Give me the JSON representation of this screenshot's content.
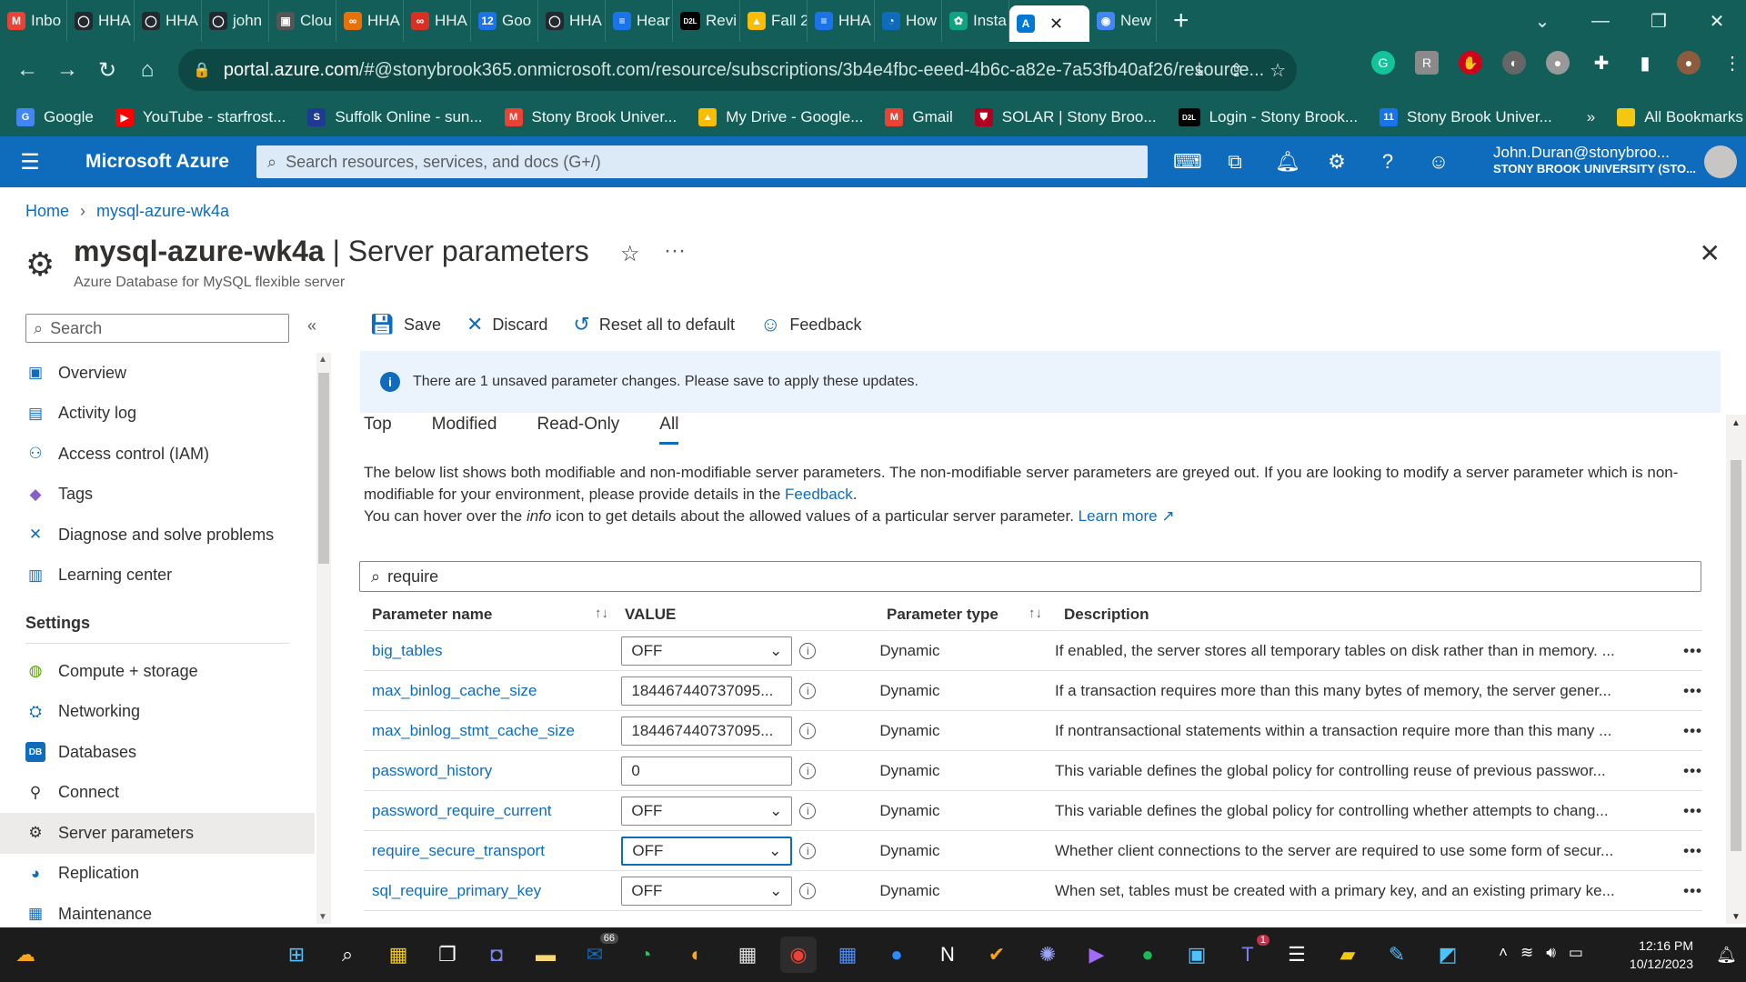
{
  "browser": {
    "tabs": [
      {
        "label": "Inbo",
        "icon": "gmail-icon",
        "color": "#ea4335",
        "glyph": "M"
      },
      {
        "label": "HHA",
        "icon": "github-icon",
        "color": "#24292f",
        "glyph": "◯"
      },
      {
        "label": "HHA",
        "icon": "github-icon",
        "color": "#24292f",
        "glyph": "◯"
      },
      {
        "label": "john",
        "icon": "github-icon",
        "color": "#24292f",
        "glyph": "◯"
      },
      {
        "label": "Clou",
        "icon": "terminal-icon",
        "color": "#555",
        "glyph": "▣"
      },
      {
        "label": "HHA",
        "icon": "infinity-icon",
        "color": "#e8710a",
        "glyph": "∞"
      },
      {
        "label": "HHA",
        "icon": "infinity-icon",
        "color": "#d93025",
        "glyph": "∞"
      },
      {
        "label": "Goo",
        "icon": "calendar-icon",
        "color": "#1a73e8",
        "glyph": "12"
      },
      {
        "label": "HHA",
        "icon": "github-icon",
        "color": "#24292f",
        "glyph": "◯"
      },
      {
        "label": "Hear",
        "icon": "docs-icon",
        "color": "#1a73e8",
        "glyph": "≡"
      },
      {
        "label": "Revi",
        "icon": "d2l-icon",
        "color": "#000",
        "glyph": "D2L"
      },
      {
        "label": "Fall 2",
        "icon": "drive-icon",
        "color": "#fbbc04",
        "glyph": "▲"
      },
      {
        "label": "HHA",
        "icon": "docs-icon",
        "color": "#1a73e8",
        "glyph": "≡"
      },
      {
        "label": "How",
        "icon": "edge-icon",
        "color": "#0f6cbd",
        "glyph": "◔"
      },
      {
        "label": "Insta",
        "icon": "chatgpt-icon",
        "color": "#10a37f",
        "glyph": "✿"
      },
      {
        "label": "",
        "icon": "azure-icon",
        "color": "#0078d4",
        "glyph": "A",
        "active": true
      },
      {
        "label": "New",
        "icon": "chrome-icon",
        "color": "#4285f4",
        "glyph": "◉"
      }
    ],
    "url_domain": "portal.azure.com",
    "url_rest": "/#@stonybrook365.onmicrosoft.com/resource/subscriptions/3b4e4fbc-eeed-4b6c-a82e-7a53fb40af26/resource...",
    "bookmarks": [
      {
        "label": "Google",
        "icon": "google-icon",
        "color": "#4285f4",
        "glyph": "G"
      },
      {
        "label": "YouTube - starfrost...",
        "icon": "youtube-icon",
        "color": "#ff0000",
        "glyph": "▶"
      },
      {
        "label": "Suffolk Online - sun...",
        "icon": "suffolk-icon",
        "color": "#1f3a93",
        "glyph": "S"
      },
      {
        "label": "Stony Brook Univer...",
        "icon": "gmail-icon",
        "color": "#ea4335",
        "glyph": "M"
      },
      {
        "label": "My Drive - Google...",
        "icon": "drive-icon",
        "color": "#fbbc04",
        "glyph": "▲"
      },
      {
        "label": "Gmail",
        "icon": "gmail-icon",
        "color": "#ea4335",
        "glyph": "M"
      },
      {
        "label": "SOLAR | Stony Broo...",
        "icon": "shield-icon",
        "color": "#b00020",
        "glyph": "⛊"
      },
      {
        "label": "Login - Stony Brook...",
        "icon": "d2l-icon",
        "color": "#000",
        "glyph": "D2L"
      },
      {
        "label": "Stony Brook Univer...",
        "icon": "calendar-icon",
        "color": "#1a73e8",
        "glyph": "11"
      }
    ],
    "all_bookmarks": "All Bookmarks"
  },
  "azure": {
    "brand": "Microsoft Azure",
    "search_placeholder": "Search resources, services, and docs (G+/)",
    "user": "John.Duran@stonybroo...",
    "org": "STONY BROOK UNIVERSITY (STO..."
  },
  "breadcrumb": {
    "home": "Home",
    "resource": "mysql-azure-wk4a"
  },
  "page": {
    "resource": "mysql-azure-wk4a",
    "section": "Server parameters",
    "subtitle": "Azure Database for MySQL flexible server"
  },
  "sidebar": {
    "search_placeholder": "Search",
    "items": [
      {
        "label": "Overview",
        "icon": "overview-icon",
        "glyph": "▣",
        "color": "#0f6cbd"
      },
      {
        "label": "Activity log",
        "icon": "activity-log-icon",
        "glyph": "▤",
        "color": "#0f6cbd"
      },
      {
        "label": "Access control (IAM)",
        "icon": "iam-icon",
        "glyph": "⚇",
        "color": "#0f6cbd"
      },
      {
        "label": "Tags",
        "icon": "tag-icon",
        "glyph": "◆",
        "color": "#8661c5"
      },
      {
        "label": "Diagnose and solve problems",
        "icon": "diagnose-icon",
        "glyph": "✕",
        "color": "#0f6cbd"
      },
      {
        "label": "Learning center",
        "icon": "learning-icon",
        "glyph": "▥",
        "color": "#0f6cbd"
      }
    ],
    "settings_heading": "Settings",
    "settings_items": [
      {
        "label": "Compute + storage",
        "icon": "compute-icon",
        "glyph": "◍",
        "color": "#57a300"
      },
      {
        "label": "Networking",
        "icon": "network-icon",
        "glyph": "⛭",
        "color": "#0f6cbd"
      },
      {
        "label": "Databases",
        "icon": "database-icon",
        "glyph": "DB",
        "color": "#0f6cbd"
      },
      {
        "label": "Connect",
        "icon": "plug-icon",
        "glyph": "⚲",
        "color": "#323130"
      },
      {
        "label": "Server parameters",
        "icon": "gear-icon",
        "glyph": "⚙",
        "color": "#323130",
        "selected": true
      },
      {
        "label": "Replication",
        "icon": "globe-icon",
        "glyph": "◕",
        "color": "#0f6cbd"
      },
      {
        "label": "Maintenance",
        "icon": "maintenance-icon",
        "glyph": "▦",
        "color": "#0f6cbd"
      }
    ]
  },
  "toolbar": {
    "save": "Save",
    "discard": "Discard",
    "reset": "Reset all to default",
    "feedback": "Feedback"
  },
  "banner": "There are 1 unsaved parameter changes.  Please save to apply these updates.",
  "tabs": [
    "Top",
    "Modified",
    "Read-Only",
    "All"
  ],
  "active_tab": "All",
  "description": {
    "line1": "The below list shows both modifiable and non-modifiable server parameters. The non-modifiable server parameters are greyed out. If you are looking to modify a server parameter which is non-modifiable for your environment, please provide details in the",
    "feedback_link": "Feedback",
    "line2a": "You can hover over the",
    "info_word": "info",
    "line2b": "icon to get details about the allowed values of a particular server parameter.",
    "learn_more": "Learn more"
  },
  "filter_value": "require",
  "table": {
    "headers": {
      "name": "Parameter name",
      "value": "VALUE",
      "type": "Parameter type",
      "description": "Description"
    },
    "rows": [
      {
        "name": "big_tables",
        "value": "OFF",
        "kind": "select",
        "type": "Dynamic",
        "description": "If enabled, the server stores all temporary tables on disk rather than in memory. ..."
      },
      {
        "name": "max_binlog_cache_size",
        "value": "184467440737095...",
        "kind": "input",
        "type": "Dynamic",
        "description": "If a transaction requires more than this many bytes of memory, the server gener..."
      },
      {
        "name": "max_binlog_stmt_cache_size",
        "value": "184467440737095...",
        "kind": "input",
        "type": "Dynamic",
        "description": "If nontransactional statements within a transaction require more than this many ..."
      },
      {
        "name": "password_history",
        "value": "0",
        "kind": "input",
        "type": "Dynamic",
        "description": "This variable defines the global policy for controlling reuse of previous passwor..."
      },
      {
        "name": "password_require_current",
        "value": "OFF",
        "kind": "select",
        "type": "Dynamic",
        "description": "This variable defines the global policy for controlling whether attempts to chang..."
      },
      {
        "name": "require_secure_transport",
        "value": "OFF",
        "kind": "select",
        "focused": true,
        "type": "Dynamic",
        "description": "Whether client connections to the server are required to use some form of secur..."
      },
      {
        "name": "sql_require_primary_key",
        "value": "OFF",
        "kind": "select",
        "type": "Dynamic",
        "description": "When set, tables must be created with a primary key, and an existing primary ke..."
      }
    ]
  },
  "taskbar": {
    "time": "12:16 PM",
    "date": "10/12/2023",
    "mail_badge": "66",
    "teams_badge": "1"
  }
}
